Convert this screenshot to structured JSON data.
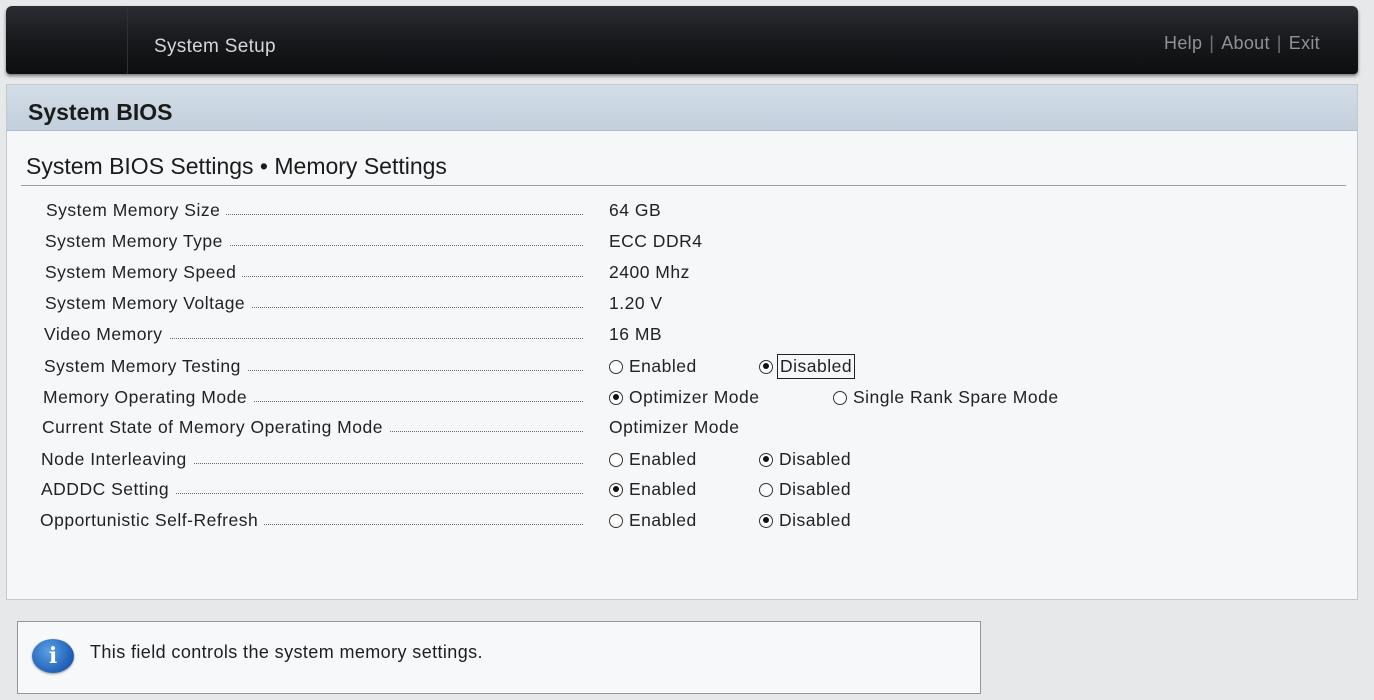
{
  "header": {
    "title": "System Setup",
    "links": [
      "Help",
      "About",
      "Exit"
    ],
    "separator": "|"
  },
  "panel": {
    "heading": "System BIOS",
    "subtitle": "System BIOS Settings • Memory Settings"
  },
  "settings": [
    {
      "label": "System Memory Size",
      "value": "64 GB"
    },
    {
      "label": "System Memory Type",
      "value": "ECC DDR4"
    },
    {
      "label": "System Memory Speed",
      "value": "2400 Mhz"
    },
    {
      "label": "System Memory Voltage",
      "value": "1.20 V"
    },
    {
      "label": "Video Memory",
      "value": "16 MB"
    },
    {
      "label": "System Memory Testing",
      "options": [
        "Enabled",
        "Disabled"
      ],
      "selected": "Disabled",
      "focused": true
    },
    {
      "label": "Memory Operating Mode",
      "options": [
        "Optimizer Mode",
        "Single Rank Spare Mode"
      ],
      "selected": "Optimizer Mode"
    },
    {
      "label": "Current State of Memory Operating Mode",
      "value": "Optimizer Mode"
    },
    {
      "label": "Node Interleaving",
      "options": [
        "Enabled",
        "Disabled"
      ],
      "selected": "Disabled"
    },
    {
      "label": "ADDDC Setting",
      "options": [
        "Enabled",
        "Disabled"
      ],
      "selected": "Enabled"
    },
    {
      "label": "Opportunistic Self-Refresh",
      "options": [
        "Enabled",
        "Disabled"
      ],
      "selected": "Disabled"
    }
  ],
  "info": {
    "icon": "info-icon",
    "message": "This field controls the system memory settings."
  },
  "colors": {
    "topbar": "#16181b",
    "panel_header": "#c8d4e0",
    "info_icon": "#1f5fb5"
  }
}
